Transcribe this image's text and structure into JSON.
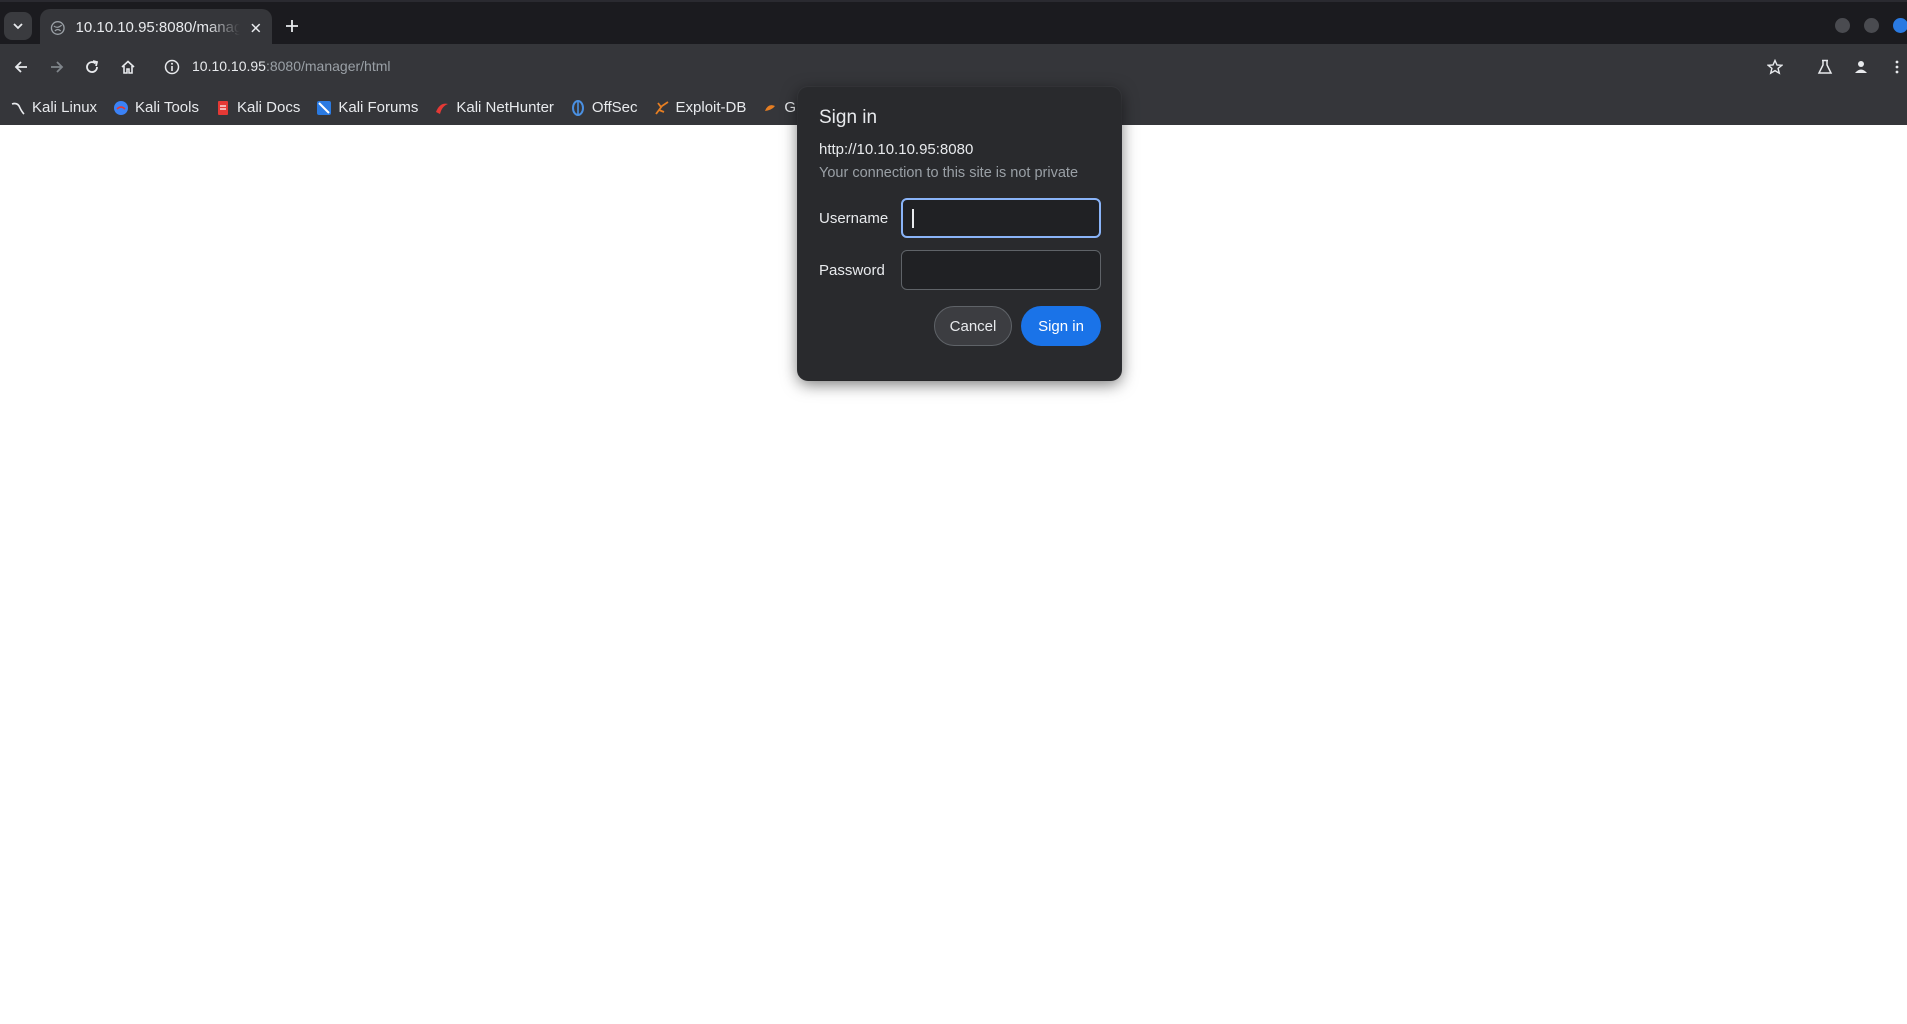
{
  "tab": {
    "title": "10.10.10.95:8080/manager/html"
  },
  "address_bar": {
    "host": "10.10.10.95",
    "path": ":8080/manager/html"
  },
  "bookmarks": [
    {
      "label": "Kali Linux",
      "icon": "kali-dragon-icon",
      "color": "#e8eaed"
    },
    {
      "label": "Kali Tools",
      "icon": "kali-tools-icon",
      "color": "#3b82f6"
    },
    {
      "label": "Kali Docs",
      "icon": "kali-docs-icon",
      "color": "#e53935"
    },
    {
      "label": "Kali Forums",
      "icon": "kali-forums-icon",
      "color": "#2a7ae2"
    },
    {
      "label": "Kali NetHunter",
      "icon": "kali-nethunter-icon",
      "color": "#e53935"
    },
    {
      "label": "OffSec",
      "icon": "offsec-icon",
      "color": "#4a90e2"
    },
    {
      "label": "Exploit-DB",
      "icon": "exploit-db-icon",
      "color": "#e67e22"
    },
    {
      "label": "G",
      "icon": "ghdb-icon",
      "color": "#e67e22"
    }
  ],
  "dialog": {
    "title": "Sign in",
    "origin": "http://10.10.10.95:8080",
    "warning": "Your connection to this site is not private",
    "username_label": "Username",
    "username_value": "",
    "password_label": "Password",
    "password_value": "",
    "cancel_label": "Cancel",
    "signin_label": "Sign in"
  },
  "colors": {
    "accent": "#1a73e8",
    "focus_ring": "#8ab4f8",
    "dialog_bg": "#292a2d"
  }
}
